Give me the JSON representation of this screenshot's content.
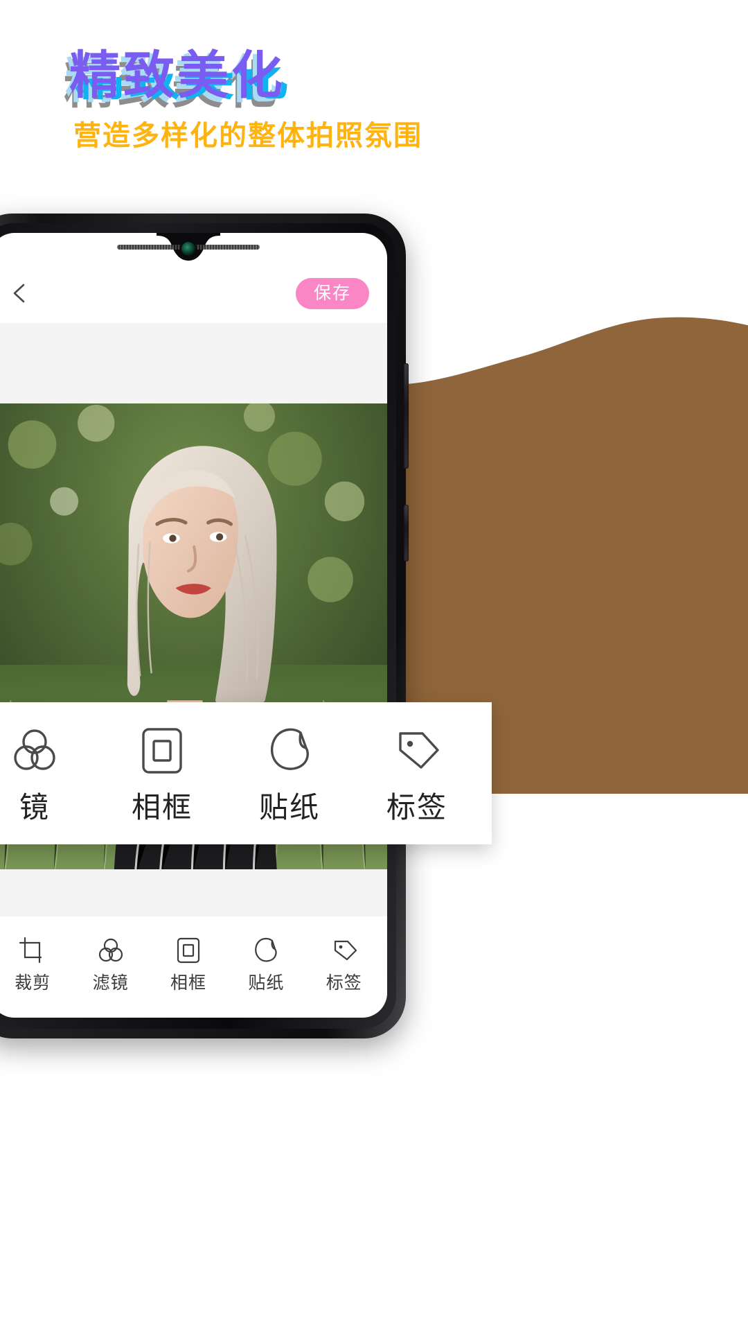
{
  "hero": {
    "title": "精致美化",
    "subtitle": "营造多样化的整体拍照氛围",
    "title_color": "#7a5cf0",
    "title_shadow_sky": "#a9dcf4",
    "title_shadow_cyan": "#11b2f0",
    "title_shadow_gray": "#8d8d8d",
    "subtitle_color": "#ffb310"
  },
  "decor": {
    "blob_color": "#8f653b"
  },
  "phone": {
    "appbar": {
      "back_icon": "chevron-left-icon",
      "save_label": "保存",
      "save_color": "#fb86c6"
    },
    "canvas": {
      "pad_color": "#f4f4f4"
    },
    "toolbar": {
      "items": [
        {
          "label": "裁剪",
          "icon": "crop-icon"
        },
        {
          "label": "滤镜",
          "icon": "filter-circles-icon"
        },
        {
          "label": "相框",
          "icon": "frame-icon"
        },
        {
          "label": "贴纸",
          "icon": "sticker-icon"
        },
        {
          "label": "标签",
          "icon": "tag-icon"
        }
      ]
    }
  },
  "callout": {
    "items": [
      {
        "label": "镜",
        "icon": "filter-circles-icon"
      },
      {
        "label": "相框",
        "icon": "frame-icon"
      },
      {
        "label": "贴纸",
        "icon": "sticker-icon"
      },
      {
        "label": "标签",
        "icon": "tag-icon"
      }
    ]
  }
}
